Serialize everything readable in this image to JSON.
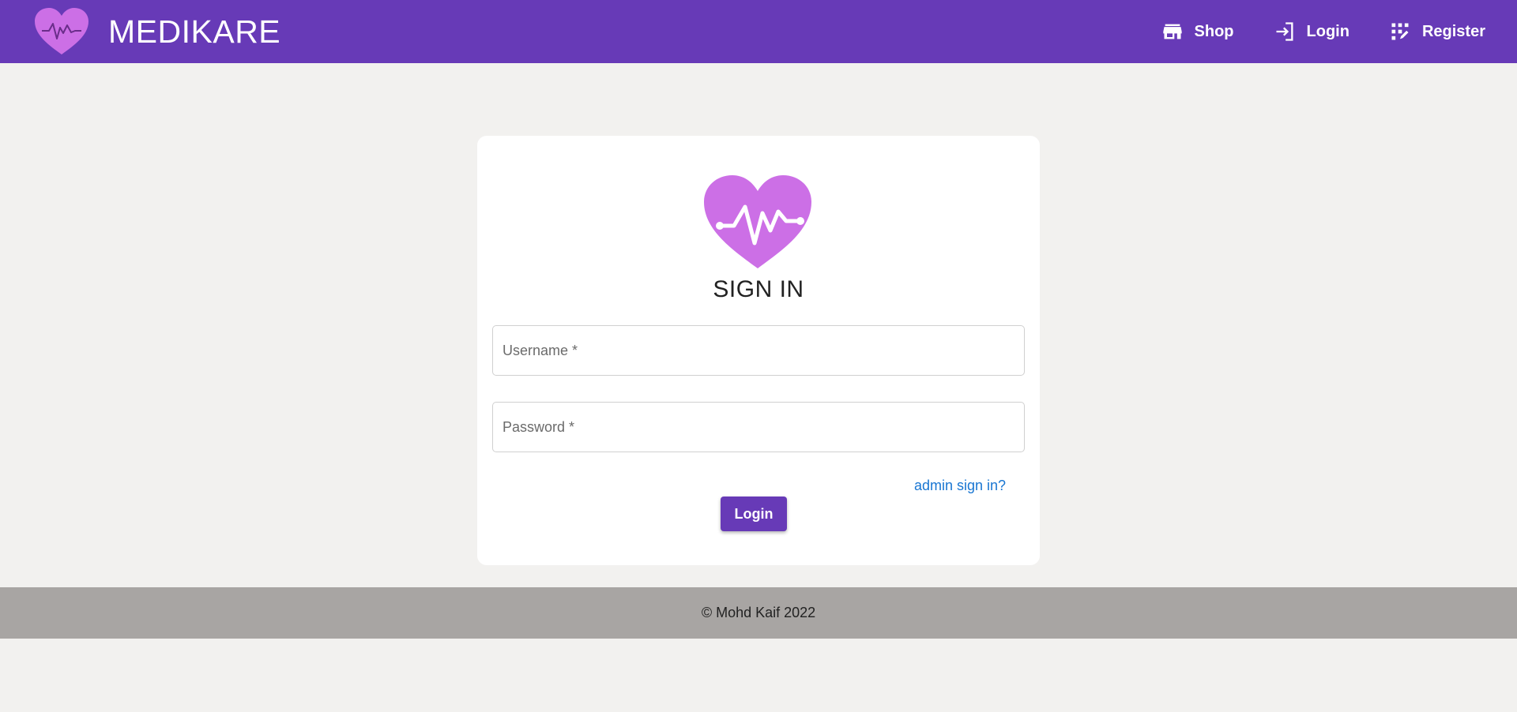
{
  "header": {
    "brand_title": "MEDIKARE",
    "brand_logo_icon": "heart-pulse-icon",
    "nav": [
      {
        "label": "Shop",
        "icon": "store-icon"
      },
      {
        "label": "Login",
        "icon": "login-icon"
      },
      {
        "label": "Register",
        "icon": "app-registration-icon"
      }
    ]
  },
  "card": {
    "logo_icon": "heart-pulse-icon",
    "title": "SIGN IN",
    "username_placeholder": "Username *",
    "password_placeholder": "Password *",
    "admin_link": "admin sign in?",
    "login_button": "Login"
  },
  "footer": {
    "text": "© Mohd Kaif 2022"
  },
  "colors": {
    "primary": "#673ab7",
    "heart": "#cc6fe6",
    "link": "#1976d2",
    "background": "#f2f1ef",
    "footer": "#a8a5a3"
  }
}
